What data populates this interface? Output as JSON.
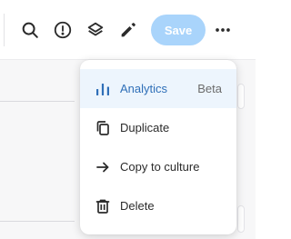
{
  "toolbar": {
    "search_icon": "search-icon",
    "alert_icon": "alert-circle-icon",
    "layers_icon": "layers-icon",
    "edit_icon": "pencil-icon",
    "save_label": "Save",
    "more_icon": "more-horizontal-icon"
  },
  "menu": {
    "items": [
      {
        "label": "Analytics",
        "badge": "Beta",
        "icon": "bar-chart-icon",
        "active": true
      },
      {
        "label": "Duplicate",
        "icon": "duplicate-icon"
      },
      {
        "label": "Copy to culture",
        "icon": "arrow-right-icon"
      },
      {
        "label": "Delete",
        "icon": "trash-icon"
      }
    ]
  },
  "colors": {
    "accent": "#2f6fb8",
    "save_button": "#a9d4fb",
    "active_item_bg": "#edf5fd"
  }
}
